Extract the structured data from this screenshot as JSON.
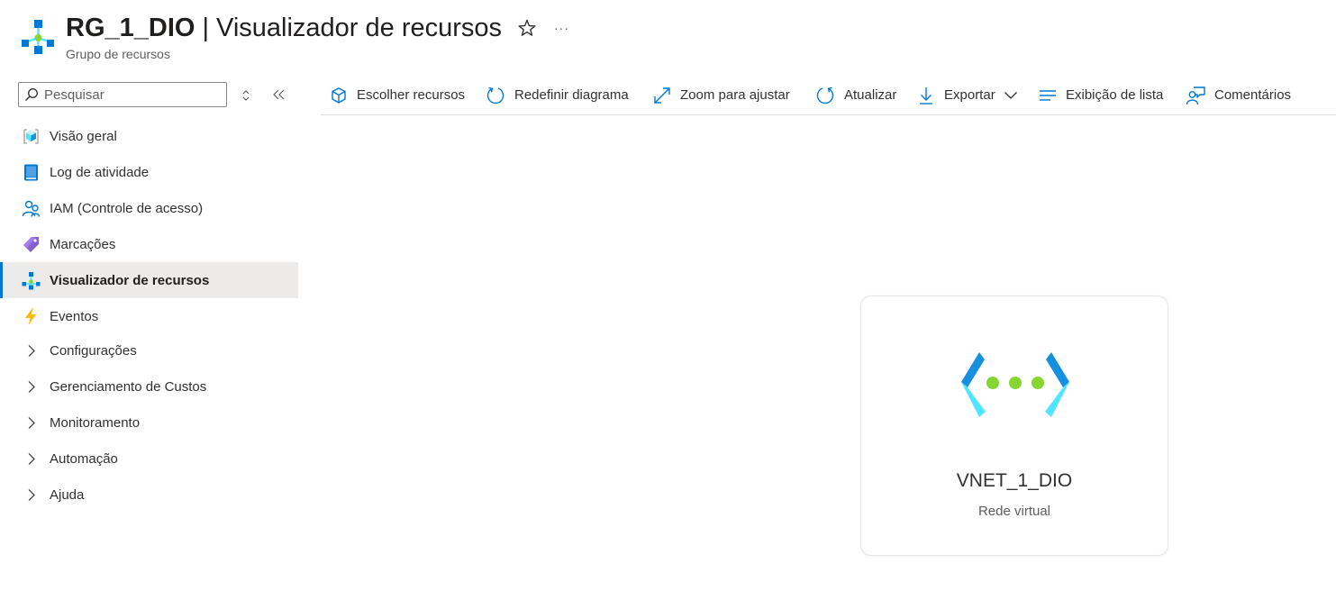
{
  "header": {
    "title_resource": "RG_1_DIO",
    "title_separator": "|",
    "title_page": "Visualizador de recursos",
    "subtitle": "Grupo de recursos",
    "more_label": "···"
  },
  "sidebar": {
    "search": {
      "placeholder": "Pesquisar",
      "value": ""
    },
    "items": [
      {
        "label": "Visão geral",
        "icon": "overview-cube-icon"
      },
      {
        "label": "Log de atividade",
        "icon": "activity-log-icon"
      },
      {
        "label": "IAM (Controle de acesso)",
        "icon": "iam-people-icon"
      },
      {
        "label": "Marcações",
        "icon": "tag-icon"
      },
      {
        "label": "Visualizador de recursos",
        "icon": "resource-visualizer-icon",
        "active": true
      },
      {
        "label": "Eventos",
        "icon": "lightning-bolt-icon"
      }
    ],
    "groups": [
      {
        "label": "Configurações"
      },
      {
        "label": "Gerenciamento de Custos"
      },
      {
        "label": "Monitoramento"
      },
      {
        "label": "Automação"
      },
      {
        "label": "Ajuda"
      }
    ]
  },
  "toolbar": {
    "choose_resources": "Escolher recursos",
    "reset_diagram": "Redefinir diagrama",
    "zoom_to_fit": "Zoom para ajustar",
    "refresh": "Atualizar",
    "export": "Exportar",
    "list_view": "Exibição de lista",
    "feedback": "Comentários"
  },
  "canvas": {
    "resource": {
      "name": "VNET_1_DIO",
      "type": "Rede virtual",
      "icon": "virtual-network-icon"
    }
  },
  "colors": {
    "accent": "#0078d4",
    "active_bg": "#edebe9",
    "vnet_blue": "#1490df",
    "vnet_cyan": "#50e6ff",
    "vnet_green": "#86d633"
  }
}
